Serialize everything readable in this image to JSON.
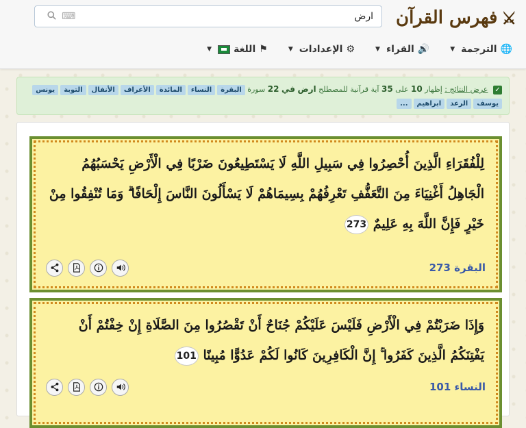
{
  "brand": {
    "title": "فهرس القرآن"
  },
  "search": {
    "value": "ارض"
  },
  "nav": {
    "translation": "الترجمة",
    "readers": "القراء",
    "settings": "الإعدادات",
    "language": "اللغة"
  },
  "results": {
    "label": "عرض النتائج :",
    "text1": "إظهار",
    "shown": "10",
    "text2": "على",
    "total": "35",
    "text3": "آية قرآنية للمصطلح",
    "term": "ارض",
    "text4": "في",
    "surah_count": "22",
    "text5": "سورة",
    "surahs": [
      "البقرة",
      "النساء",
      "المائدة",
      "الأعراف",
      "الأنفال",
      "التوبة",
      "يونس",
      "يوسف",
      "الرعد",
      "ابراهيم"
    ],
    "more": "..."
  },
  "verses": [
    {
      "text": "لِلْفُقَرَاءِ الَّذِينَ أُحْصِرُوا فِي سَبِيلِ اللَّهِ لَا يَسْتَطِيعُونَ ضَرْبًا فِي الْأَرْضِ يَحْسَبُهُمُ الْجَاهِلُ أَغْنِيَاءَ مِنَ التَّعَفُّفِ تَعْرِفُهُمْ بِسِيمَاهُمْ لَا يَسْأَلُونَ النَّاسَ إِلْحَافًا ۗ وَمَا تُنْفِقُوا مِنْ خَيْرٍ فَإِنَّ اللَّهَ بِهِ عَلِيمٌ",
      "number": "273",
      "ref": "البقرة 273"
    },
    {
      "text": "وَإِذَا ضَرَبْتُمْ فِي الْأَرْضِ فَلَيْسَ عَلَيْكُمْ جُنَاحٌ أَنْ تَقْصُرُوا مِنَ الصَّلَاةِ إِنْ خِفْتُمْ أَنْ يَفْتِنَكُمُ الَّذِينَ كَفَرُوا ۚ إِنَّ الْكَافِرِينَ كَانُوا لَكُمْ عَدُوًّا مُبِينًا",
      "number": "101",
      "ref": "النساء 101"
    }
  ],
  "icons": {
    "brand": "crossed-swords-icon",
    "search": "search-icon",
    "keyboard": "keyboard-icon",
    "translation": "globe-icon",
    "readers": "speaker-icon",
    "settings": "gear-icon",
    "language": "flag-icon",
    "actions": [
      "share-icon",
      "pdf-icon",
      "info-icon",
      "audio-icon"
    ]
  },
  "colors": {
    "verse_bg": "#fcf2a2",
    "verse_border": "#6b8f30",
    "ref_text": "#3a5aa8",
    "alert_bg": "#dff0d8",
    "tag_bg": "#b8d7ea"
  }
}
